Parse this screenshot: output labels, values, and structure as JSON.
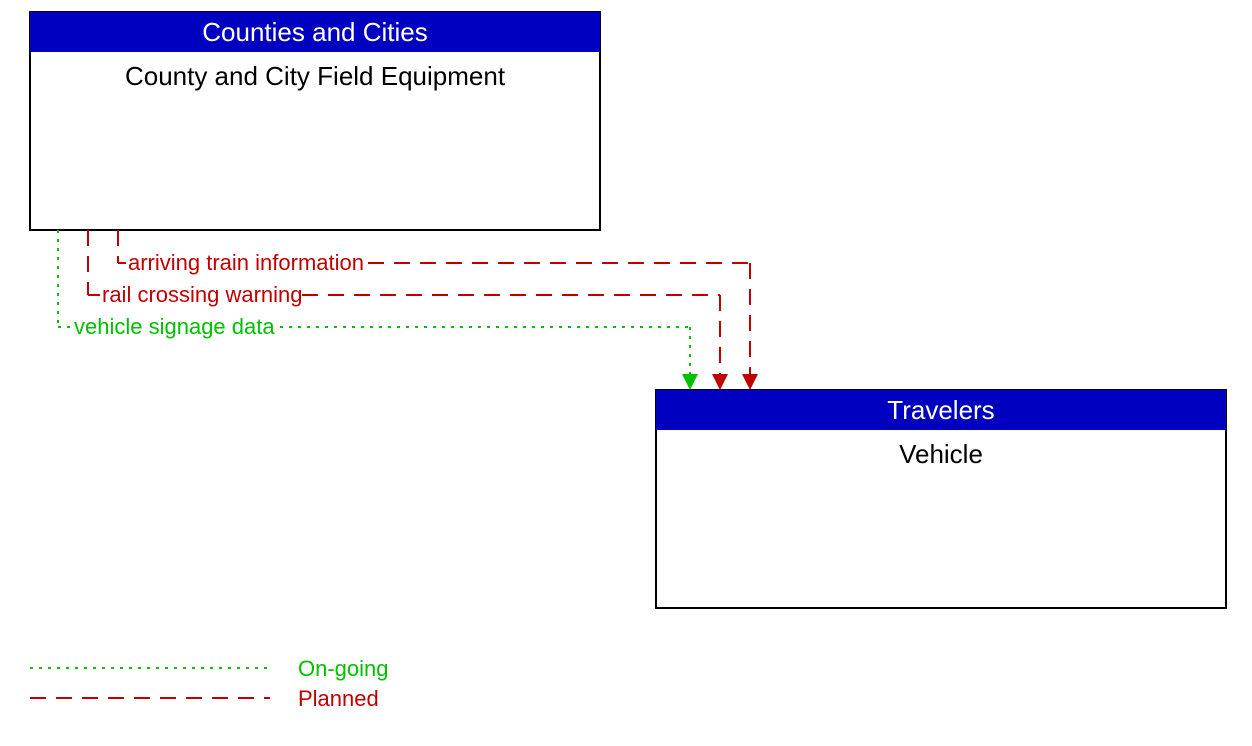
{
  "boxes": {
    "source": {
      "header": "Counties and Cities",
      "body": "County and City Field Equipment"
    },
    "target": {
      "header": "Travelers",
      "body": "Vehicle"
    }
  },
  "flows": {
    "f1": {
      "label": "arriving train information"
    },
    "f2": {
      "label": "rail crossing warning"
    },
    "f3": {
      "label": "vehicle signage data"
    }
  },
  "legend": {
    "ongoing": "On-going",
    "planned": "Planned"
  }
}
